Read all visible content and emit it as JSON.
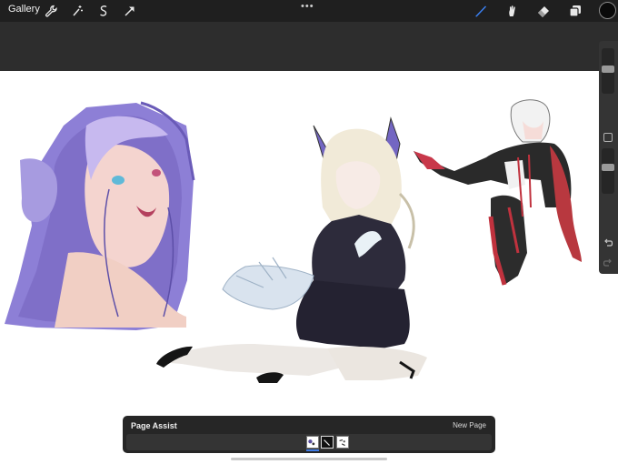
{
  "toolbar": {
    "gallery_label": "Gallery",
    "left_tools": [
      {
        "name": "wrench-icon"
      },
      {
        "name": "magic-wand-icon"
      },
      {
        "name": "selection-icon"
      },
      {
        "name": "transform-arrow-icon"
      }
    ],
    "more_label": "•••",
    "right_tools": [
      {
        "name": "brush-icon",
        "active": true
      },
      {
        "name": "smudge-icon"
      },
      {
        "name": "eraser-icon"
      },
      {
        "name": "layers-icon"
      }
    ],
    "current_color": "#0a0a0a",
    "active_tool_color": "#3b82f6"
  },
  "sidebar": {
    "brush_size_level": 0.55,
    "opacity_level": 0.6,
    "icons": [
      "modify-square-icon",
      "undo-icon",
      "redo-icon"
    ]
  },
  "page_assist": {
    "title": "Page Assist",
    "new_page_label": "New Page",
    "pages": [
      {
        "name": "page-1",
        "selected": true
      },
      {
        "name": "page-2",
        "selected": false
      },
      {
        "name": "page-3",
        "selected": false
      }
    ]
  },
  "colors": {
    "toolbar_bg": "#1f1f1f",
    "band_bg": "#2d2d2d",
    "canvas_bg": "#ffffff",
    "accent": "#3f7be5"
  }
}
